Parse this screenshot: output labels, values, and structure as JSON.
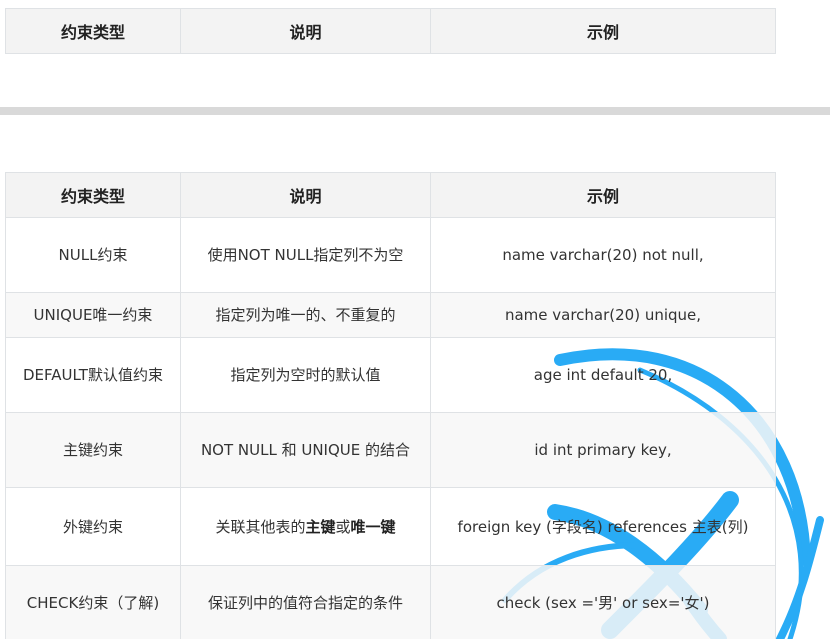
{
  "top_table": {
    "headers": [
      "约束类型",
      "说明",
      "示例"
    ]
  },
  "main_table": {
    "headers": [
      "约束类型",
      "说明",
      "示例"
    ],
    "rows": [
      {
        "type": "NULL约束",
        "desc_parts": [
          "使用NOT NULL指定列不为空"
        ],
        "example": "name varchar(20) not null,"
      },
      {
        "type": "UNIQUE唯一约束",
        "desc_parts": [
          "指定列为唯一的、不重复的"
        ],
        "example": "name varchar(20) unique,"
      },
      {
        "type": "DEFAULT默认值约束",
        "desc_parts": [
          "指定列为空时的默认值"
        ],
        "example": "age int default 20,"
      },
      {
        "type": "主键约束",
        "desc_parts": [
          "NOT NULL 和 UNIQUE 的结合"
        ],
        "example": "id int primary key,"
      },
      {
        "type": "外键约束",
        "desc_parts": [
          "关联其他表的",
          "主键",
          "或",
          "唯一键"
        ],
        "example": "foreign key (字段名) references 主表(列)"
      },
      {
        "type": "CHECK约束（了解)",
        "desc_parts": [
          "保证列中的值符合指定的条件"
        ],
        "example": "check (sex ='男' or sex='女')"
      }
    ]
  },
  "colors": {
    "header_bg": "#f3f3f3",
    "border": "#dfe2e5",
    "separator": "#d9d9d9",
    "watermark": "#1ea7f5"
  }
}
